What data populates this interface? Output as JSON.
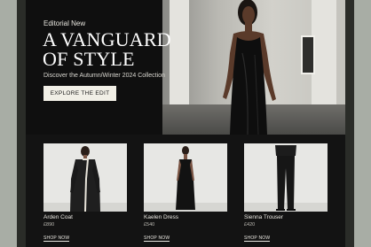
{
  "hero": {
    "eyebrow": "Editorial New",
    "headline_line1": "A VANGUARD",
    "headline_line2": "OF STYLE",
    "subhead": "Discover the Autumn/Winter 2024 Collection",
    "cta_label": "EXPLORE THE EDIT"
  },
  "products": [
    {
      "name": "Arden Coat",
      "price": "£890",
      "link": "SHOP NOW"
    },
    {
      "name": "Kaelen Dress",
      "price": "£540",
      "link": "SHOP NOW"
    },
    {
      "name": "Sienna Trouser",
      "price": "£420",
      "link": "SHOP NOW"
    }
  ],
  "colors": {
    "background": "#131313",
    "cta_background": "#f1efe6",
    "text": "#ffffff"
  }
}
